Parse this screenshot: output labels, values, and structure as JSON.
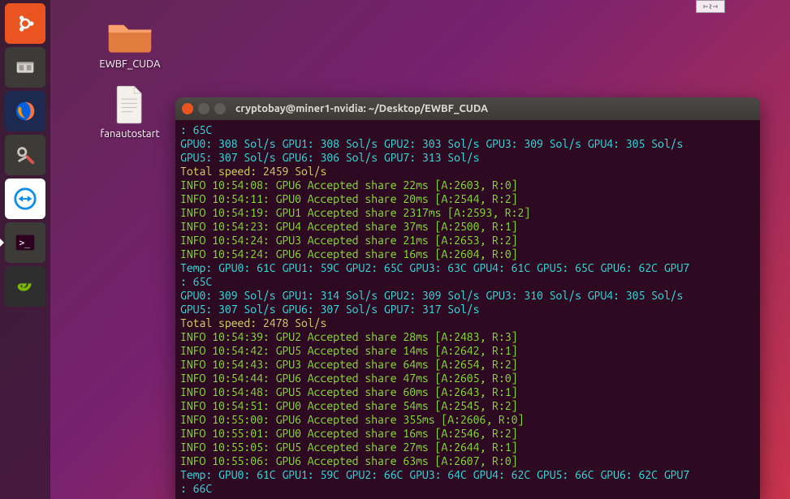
{
  "launcher": {
    "items": [
      {
        "name": "ubuntu-dash",
        "color": "#e95420"
      },
      {
        "name": "files",
        "color": "#bdbdbd"
      },
      {
        "name": "firefox",
        "color": "#ff7139"
      },
      {
        "name": "settings",
        "color": "#9e9e9e"
      },
      {
        "name": "teamviewer",
        "color": "#0e8ee9"
      },
      {
        "name": "terminal",
        "color": "#2c001e"
      },
      {
        "name": "nvidia",
        "color": "#76b900"
      }
    ]
  },
  "desktop": {
    "folder": {
      "label": "EWBF_CUDA"
    },
    "file": {
      "label": "fanautostart"
    }
  },
  "terminal": {
    "title": "cryptobay@miner1-nvidia: ~/Desktop/EWBF_CUDA",
    "lines": [
      {
        "cls": "c-cyan",
        "text": ": 65C"
      },
      {
        "cls": "c-cyan",
        "text": "GPU0: 308 Sol/s GPU1: 308 Sol/s GPU2: 303 Sol/s GPU3: 309 Sol/s GPU4: 305 Sol/s"
      },
      {
        "cls": "c-cyan",
        "text": "GPU5: 307 Sol/s GPU6: 306 Sol/s GPU7: 313 Sol/s"
      },
      {
        "cls": "c-yellow",
        "text": "Total speed: 2459 Sol/s"
      },
      {
        "cls": "c-green",
        "text": "INFO 10:54:08: GPU6 Accepted share 22ms [A:2603, R:0]"
      },
      {
        "cls": "c-green",
        "text": "INFO 10:54:11: GPU0 Accepted share 20ms [A:2544, R:2]"
      },
      {
        "cls": "c-green",
        "text": "INFO 10:54:19: GPU1 Accepted share 2317ms [A:2593, R:2]"
      },
      {
        "cls": "c-green",
        "text": "INFO 10:54:23: GPU4 Accepted share 37ms [A:2500, R:1]"
      },
      {
        "cls": "c-green",
        "text": "INFO 10:54:24: GPU3 Accepted share 21ms [A:2653, R:2]"
      },
      {
        "cls": "c-green",
        "text": "INFO 10:54:24: GPU6 Accepted share 16ms [A:2604, R:0]"
      },
      {
        "cls": "c-cyan",
        "text": "Temp: GPU0: 61C GPU1: 59C GPU2: 65C GPU3: 63C GPU4: 61C GPU5: 65C GPU6: 62C GPU7"
      },
      {
        "cls": "c-cyan",
        "text": ": 65C"
      },
      {
        "cls": "c-cyan",
        "text": "GPU0: 309 Sol/s GPU1: 314 Sol/s GPU2: 309 Sol/s GPU3: 310 Sol/s GPU4: 305 Sol/s"
      },
      {
        "cls": "c-cyan",
        "text": "GPU5: 307 Sol/s GPU6: 307 Sol/s GPU7: 317 Sol/s"
      },
      {
        "cls": "c-yellow",
        "text": "Total speed: 2478 Sol/s"
      },
      {
        "cls": "c-green",
        "text": "INFO 10:54:39: GPU2 Accepted share 28ms [A:2483, R:3]"
      },
      {
        "cls": "c-green",
        "text": "INFO 10:54:42: GPU5 Accepted share 14ms [A:2642, R:1]"
      },
      {
        "cls": "c-green",
        "text": "INFO 10:54:43: GPU3 Accepted share 64ms [A:2654, R:2]"
      },
      {
        "cls": "c-green",
        "text": "INFO 10:54:44: GPU6 Accepted share 47ms [A:2605, R:0]"
      },
      {
        "cls": "c-green",
        "text": "INFO 10:54:48: GPU5 Accepted share 60ms [A:2643, R:1]"
      },
      {
        "cls": "c-green",
        "text": "INFO 10:54:51: GPU0 Accepted share 54ms [A:2545, R:2]"
      },
      {
        "cls": "c-green",
        "text": "INFO 10:55:00: GPU6 Accepted share 355ms [A:2606, R:0]"
      },
      {
        "cls": "c-green",
        "text": "INFO 10:55:01: GPU0 Accepted share 16ms [A:2546, R:2]"
      },
      {
        "cls": "c-green",
        "text": "INFO 10:55:05: GPU5 Accepted share 27ms [A:2644, R:1]"
      },
      {
        "cls": "c-green",
        "text": "INFO 10:55:06: GPU6 Accepted share 63ms [A:2607, R:0]"
      },
      {
        "cls": "c-cyan",
        "text": "Temp: GPU0: 61C GPU1: 59C GPU2: 66C GPU3: 64C GPU4: 62C GPU5: 66C GPU6: 62C GPU7"
      },
      {
        "cls": "c-cyan",
        "text": ": 66C"
      }
    ]
  }
}
